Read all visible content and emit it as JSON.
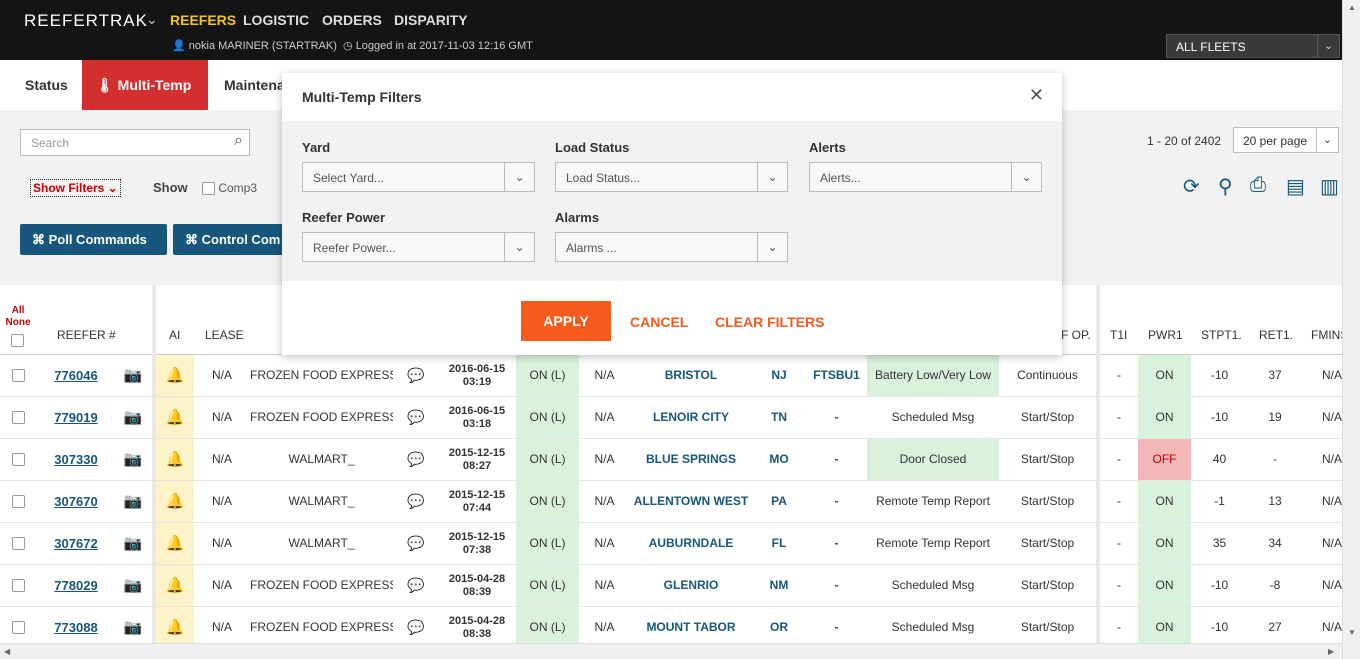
{
  "topbar": {
    "brand": "REEFERTRAK",
    "nav": [
      "REEFERS",
      "LOGISTIC",
      "ORDERS",
      "DISPARITY"
    ],
    "user": "nokia MARINER (STARTRAK)",
    "login": "Logged in at 2017-11-03 12:16 GMT",
    "fleet": "ALL FLEETS"
  },
  "tabs": [
    "Status",
    "Multi-Temp",
    "Maintena"
  ],
  "controls": {
    "search_placeholder": "Search",
    "show_filters": "Show Filters",
    "show": "Show",
    "comp3": "Comp3",
    "poll_commands": "⌘ Poll Commands",
    "control_commands": "⌘ Control Com",
    "page_info": "1 - 20 of 2402",
    "per_page": "20 per page"
  },
  "table": {
    "all": "All",
    "none": "None",
    "headers": {
      "reefer": "REEFER #",
      "ai": "AI",
      "lease": "LEASE",
      "op": "F OP.",
      "t1": "T1I",
      "pwr1": "PWR1",
      "stpt1": "STPT1.",
      "ret1": "RET1.",
      "fmin": "FMINS"
    },
    "rows": [
      {
        "id": "776046",
        "lease": "N/A",
        "customer": "FROZEN FOOD EXPRESS",
        "date": "2016-06-15",
        "time": "03:19",
        "on": "ON (L)",
        "na": "N/A",
        "city": "BRISTOL",
        "state": "NJ",
        "code": "FTSBU1",
        "event": "Battery Low/Very Low",
        "op": "Continuous",
        "t1": "-",
        "pwr": "ON",
        "stpt": "-10",
        "ret": "37",
        "fmin": "N/A"
      },
      {
        "id": "779019",
        "lease": "N/A",
        "customer": "FROZEN FOOD EXPRESS",
        "date": "2016-06-15",
        "time": "03:18",
        "on": "ON (L)",
        "na": "N/A",
        "city": "LENOIR CITY",
        "state": "TN",
        "code": "-",
        "event": "Scheduled Msg",
        "op": "Start/Stop",
        "t1": "-",
        "pwr": "ON",
        "stpt": "-10",
        "ret": "19",
        "fmin": "N/A"
      },
      {
        "id": "307330",
        "lease": "N/A",
        "customer": "WALMART_",
        "date": "2015-12-15",
        "time": "08:27",
        "on": "ON (L)",
        "na": "N/A",
        "city": "BLUE SPRINGS",
        "state": "MO",
        "code": "-",
        "event": "Door Closed",
        "op": "Start/Stop",
        "t1": "-",
        "pwr": "OFF",
        "stpt": "40",
        "ret": "-",
        "fmin": "N/A"
      },
      {
        "id": "307670",
        "lease": "N/A",
        "customer": "WALMART_",
        "date": "2015-12-15",
        "time": "07:44",
        "on": "ON (L)",
        "na": "N/A",
        "city": "ALLENTOWN WEST",
        "state": "PA",
        "code": "-",
        "event": "Remote Temp Report",
        "op": "Start/Stop",
        "t1": "-",
        "pwr": "ON",
        "stpt": "-1",
        "ret": "13",
        "fmin": "N/A"
      },
      {
        "id": "307672",
        "lease": "N/A",
        "customer": "WALMART_",
        "date": "2015-12-15",
        "time": "07:38",
        "on": "ON (L)",
        "na": "N/A",
        "city": "AUBURNDALE",
        "state": "FL",
        "code": "-",
        "event": "Remote Temp Report",
        "op": "Start/Stop",
        "t1": "-",
        "pwr": "ON",
        "stpt": "35",
        "ret": "34",
        "fmin": "N/A"
      },
      {
        "id": "778029",
        "lease": "N/A",
        "customer": "FROZEN FOOD EXPRESS",
        "date": "2015-04-28",
        "time": "08:39",
        "on": "ON (L)",
        "na": "N/A",
        "city": "GLENRIO",
        "state": "NM",
        "code": "-",
        "event": "Scheduled Msg",
        "op": "Start/Stop",
        "t1": "-",
        "pwr": "ON",
        "stpt": "-10",
        "ret": "-8",
        "fmin": "N/A"
      },
      {
        "id": "773088",
        "lease": "N/A",
        "customer": "FROZEN FOOD EXPRESS",
        "date": "2015-04-28",
        "time": "08:38",
        "on": "ON (L)",
        "na": "N/A",
        "city": "MOUNT TABOR",
        "state": "OR",
        "code": "-",
        "event": "Scheduled Msg",
        "op": "Start/Stop",
        "t1": "-",
        "pwr": "ON",
        "stpt": "-10",
        "ret": "27",
        "fmin": "N/A"
      }
    ]
  },
  "modal": {
    "title": "Multi-Temp Filters",
    "yard_label": "Yard",
    "yard_placeholder": "Select Yard...",
    "load_label": "Load Status",
    "load_placeholder": "Load Status...",
    "alerts_label": "Alerts",
    "alerts_placeholder": "Alerts...",
    "power_label": "Reefer Power",
    "power_placeholder": "Reefer Power...",
    "alarms_label": "Alarms",
    "alarms_placeholder": "Alarms ...",
    "apply": "APPLY",
    "cancel": "CANCEL",
    "clear": "CLEAR FILTERS"
  },
  "colors": {
    "accent": "#d32f2f",
    "primary": "#17577e",
    "action": "#f45b1c",
    "highlight": "#f5c518"
  }
}
